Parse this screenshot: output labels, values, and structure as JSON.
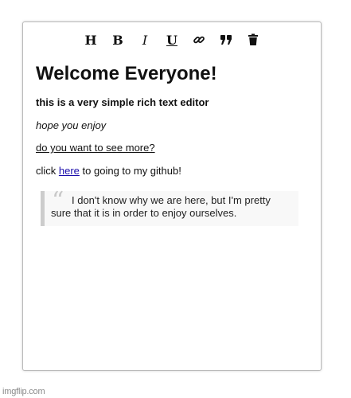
{
  "toolbar": {
    "heading_label": "H",
    "bold_label": "B",
    "italic_label": "I",
    "underline_label": "U",
    "link_icon": "link-icon",
    "quote_icon": "quote-icon",
    "delete_icon": "trash-icon"
  },
  "content": {
    "heading": "Welcome Everyone!",
    "bold_line": "this is a very simple rich text editor",
    "italic_line": "hope you enjoy",
    "underline_line": "do you want to see more?",
    "click_prefix": "click ",
    "click_link": "here",
    "click_suffix": " to going to my github!",
    "blockquote": "I don't know why we are here, but I'm pretty sure that it is in order to enjoy ourselves."
  },
  "watermark": "imgflip.com",
  "colors": {
    "link": "#1a0dab",
    "quote_border": "#cccccc",
    "quote_mark": "#c8c8c8"
  }
}
